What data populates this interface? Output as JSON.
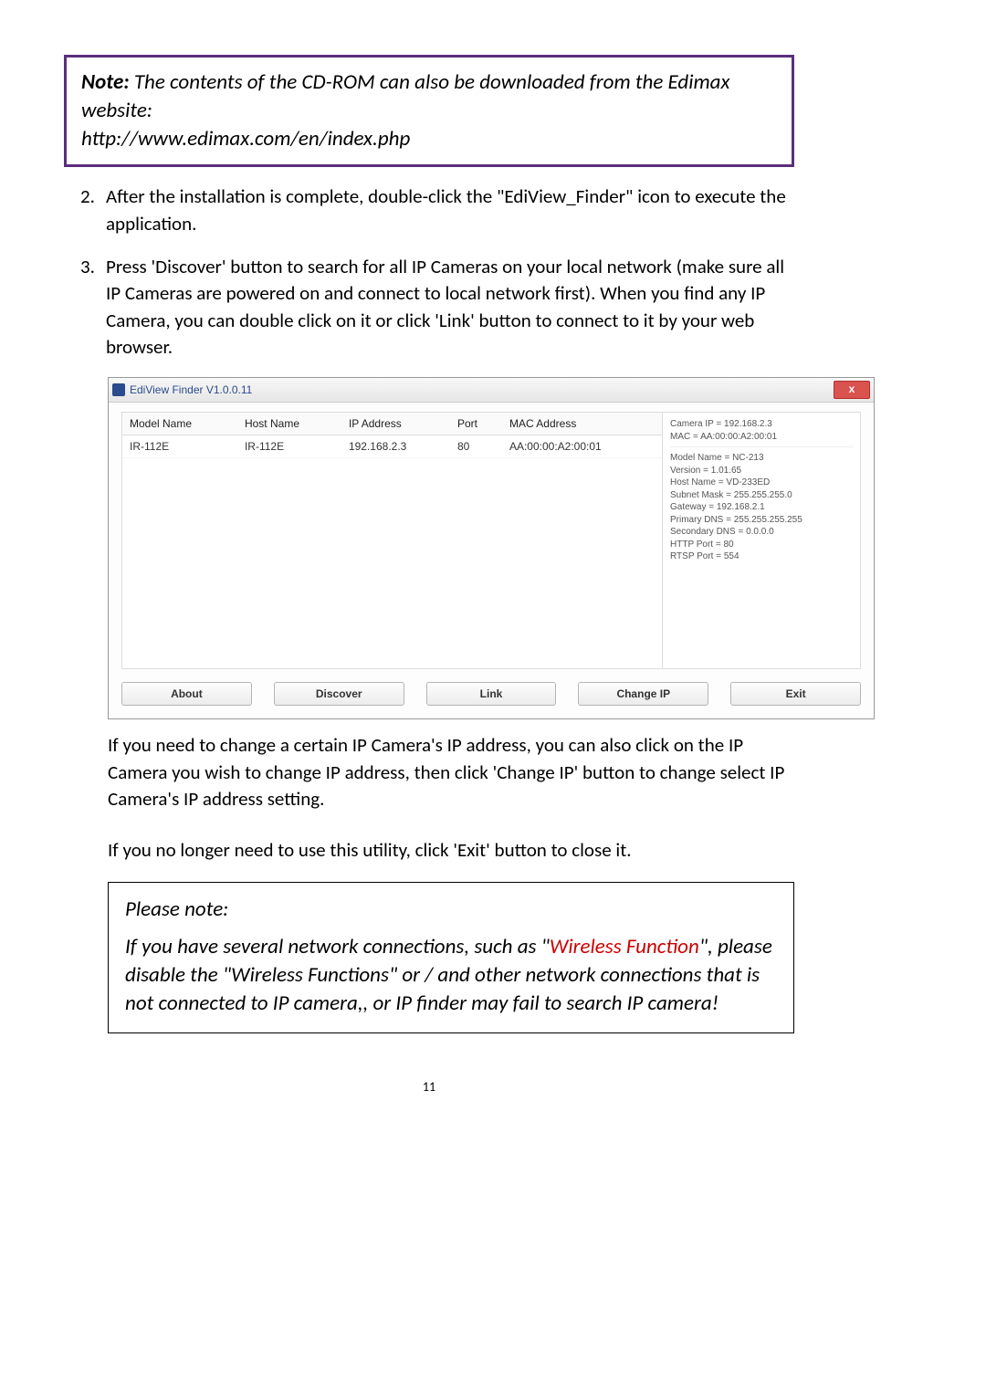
{
  "note1": {
    "label": "Note:",
    "text_a": " The contents of the CD-ROM can also be downloaded from the Edimax website:",
    "url": "http://www.edimax.com/en/index.php"
  },
  "step2": {
    "num": "2.",
    "text": "After the installation is complete, double-click the \"EdiView_Finder\" icon to execute the application."
  },
  "step3": {
    "num": "3.",
    "text": "Press 'Discover' button to search for all IP Cameras on your local network (make sure all IP Cameras are powered on and connect to local network first). When you find any IP Camera, you can double click on it or click 'Link' button to connect to it by your web browser."
  },
  "app": {
    "title": "EdiView Finder V1.0.0.11",
    "close": "x",
    "headers": {
      "model": "Model Name",
      "host": "Host Name",
      "ip": "IP Address",
      "port": "Port",
      "mac": "MAC Address"
    },
    "row": {
      "model": "IR-112E",
      "host": "IR-112E",
      "ip": "192.168.2.3",
      "port": "80",
      "mac": "AA:00:00:A2:00:01"
    },
    "details": {
      "l1": "Camera IP = 192.168.2.3",
      "l2": "MAC = AA:00:00:A2:00:01",
      "l3": "Model Name = NC-213",
      "l4": "Version = 1.01.65",
      "l5": "Host Name =  VD-233ED",
      "l6": "Subnet Mask = 255.255.255.0",
      "l7": "Gateway = 192.168.2.1",
      "l8": "Primary DNS = 255.255.255.255",
      "l9": "Secondary DNS = 0.0.0.0",
      "l10": "HTTP Port = 80",
      "l11": "RTSP Port = 554"
    },
    "buttons": {
      "about": "About",
      "discover": "Discover",
      "link": "Link",
      "changeip": "Change IP",
      "exit": "Exit"
    }
  },
  "para_after1": "If you need to change a certain IP Camera's IP address, you can also click on the IP Camera you wish to change IP address, then click 'Change IP' button to change select IP Camera's IP address setting.",
  "para_after2": "If you no longer need to use this utility, click 'Exit' button to close it.",
  "note2": {
    "heading": "Please note:",
    "part1": "If you have several network connections, such as \"",
    "wireless": "Wireless Function",
    "part2": "\", please disable the \"Wireless Functions\" or / and other network connections that is not connected to IP camera,, or IP finder may fail to search IP camera!"
  },
  "page": "11"
}
